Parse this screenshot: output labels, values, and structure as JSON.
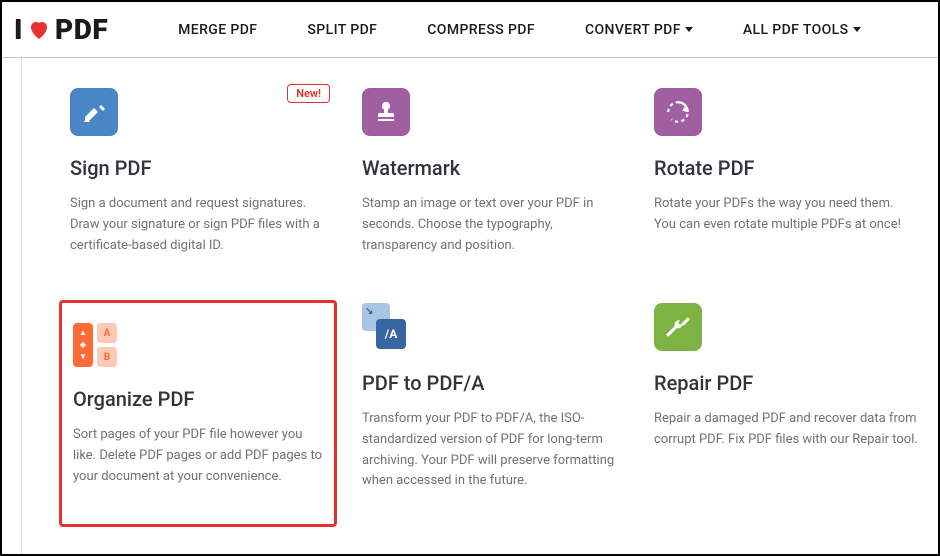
{
  "logo": {
    "prefix": "I",
    "suffix": "PDF"
  },
  "nav": {
    "merge": "MERGE PDF",
    "split": "SPLIT PDF",
    "compress": "COMPRESS PDF",
    "convert": "CONVERT PDF",
    "all": "ALL PDF TOOLS"
  },
  "badge_new": "New!",
  "cards": {
    "sign": {
      "title": "Sign PDF",
      "desc": "Sign a document and request signatures. Draw your signature or sign PDF files with a certificate-based digital ID."
    },
    "watermark": {
      "title": "Watermark",
      "desc": "Stamp an image or text over your PDF in seconds. Choose the typography, transparency and position."
    },
    "rotate": {
      "title": "Rotate PDF",
      "desc": "Rotate your PDFs the way you need them. You can even rotate multiple PDFs at once!"
    },
    "organize": {
      "title": "Organize PDF",
      "desc": "Sort pages of your PDF file however you like. Delete PDF pages or add PDF pages to your document at your convenience.",
      "pageA": "A",
      "pageB": "B"
    },
    "pdfa": {
      "title": "PDF to PDF/A",
      "desc": "Transform your PDF to PDF/A, the ISO-standardized version of PDF for long-term archiving. Your PDF will preserve formatting when accessed in the future.",
      "badge": "/A"
    },
    "repair": {
      "title": "Repair PDF",
      "desc": "Repair a damaged PDF and recover data from corrupt PDF. Fix PDF files with our Repair tool."
    }
  }
}
